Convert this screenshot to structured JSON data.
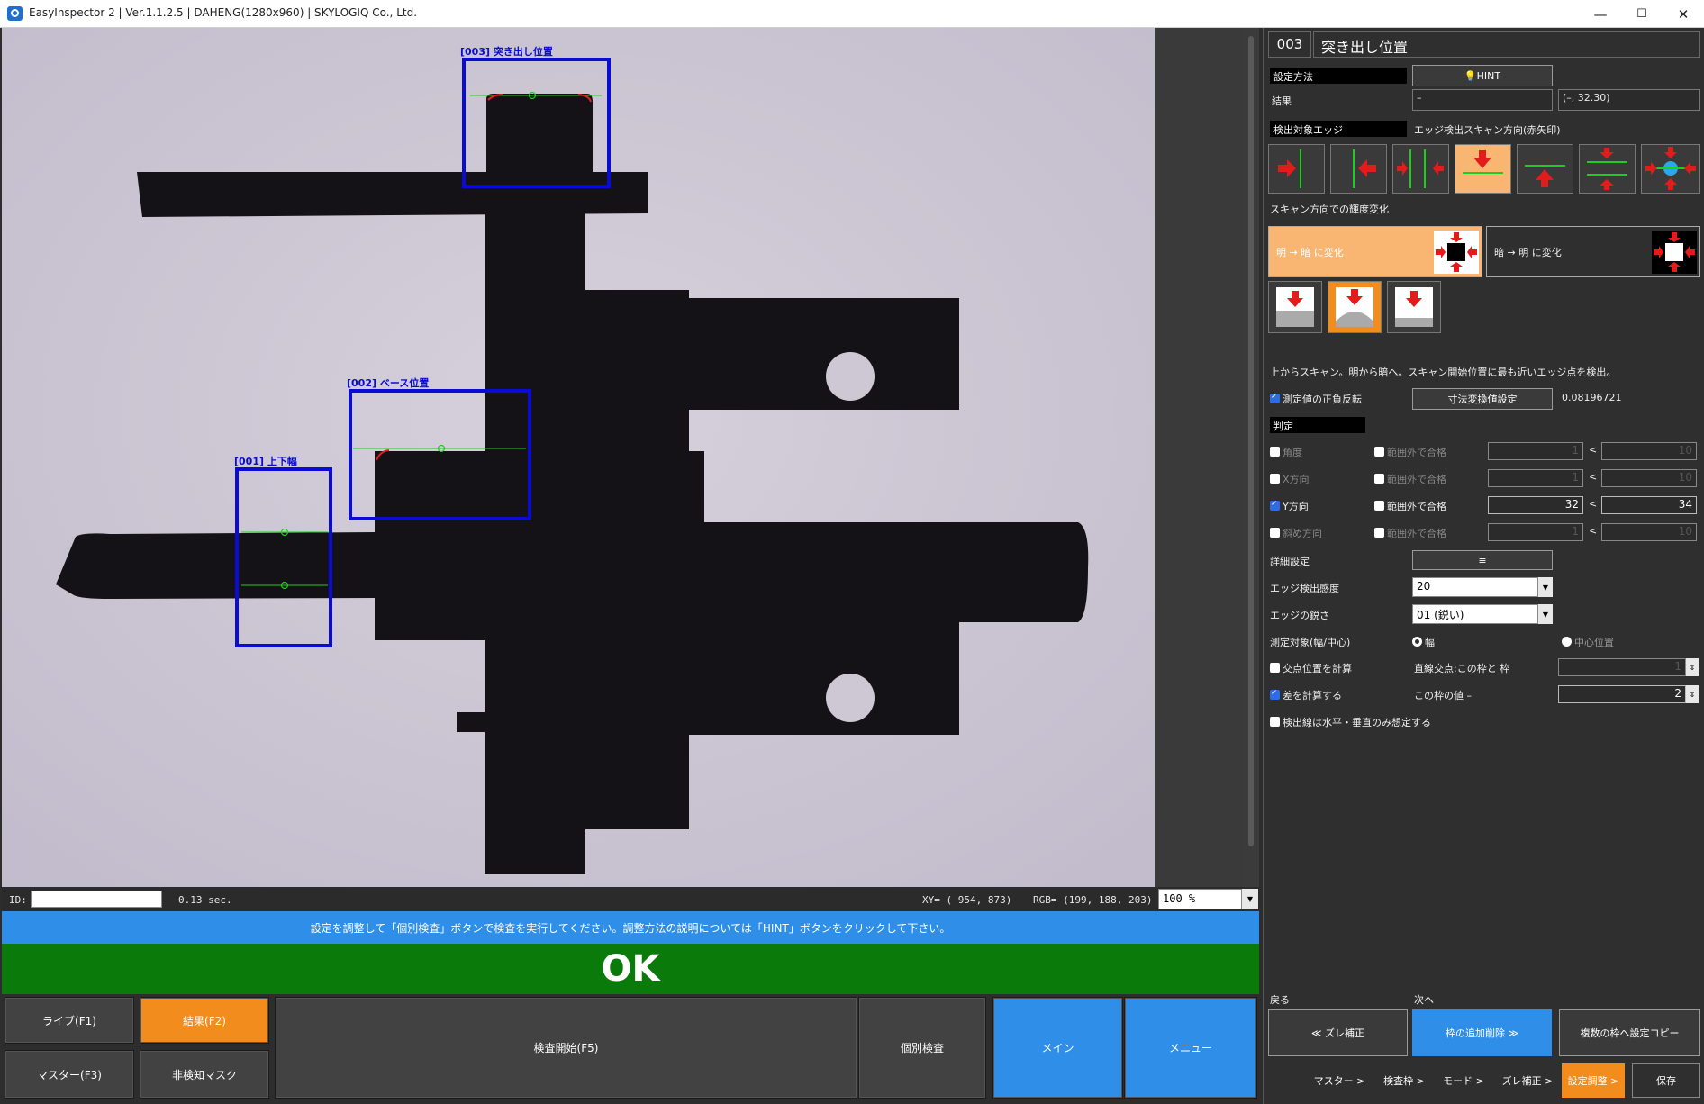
{
  "window": {
    "title": "EasyInspector 2 | Ver.1.1.2.5 | DAHENG(1280x960) | SKYLOGIQ Co., Ltd.",
    "minimize": "—",
    "maximize": "☐",
    "close": "✕"
  },
  "viewer": {
    "rois": [
      {
        "label": "[003] 突き出し位置"
      },
      {
        "label": "[002] ベース位置"
      },
      {
        "label": "[001] 上下幅"
      }
    ]
  },
  "status": {
    "id_label": "ID:",
    "id_value": "",
    "time": "0.13 sec.",
    "xy": "XY= ( 954,  873)",
    "rgb": "RGB= (199, 188, 203)",
    "zoom": "100 %"
  },
  "instruction": "設定を調整して「個別検査」ボタンで検査を実行してください。調整方法の説明については「HINT」ボタンをクリックして下さい。",
  "result": "OK",
  "bottom_buttons": {
    "live": "ライブ(F1)",
    "result": "結果(F2)",
    "master": "マスター(F3)",
    "nondetect_mask": "非検知マスク",
    "start": "検査開始(F5)",
    "individual": "個別検査",
    "main": "メイン",
    "menu": "メニュー"
  },
  "panel": {
    "roi_id": "003",
    "roi_name": "突き出し位置",
    "setting_method": "設定方法",
    "hint": "HINT",
    "result_label": "結果",
    "result_value": "–",
    "result_coords": "(–, 32.30)",
    "target_edge": "検出対象エッジ",
    "scan_direction": "エッジ検出スキャン方向(赤矢印)",
    "brightness_change": "スキャン方向での輝度変化",
    "light_to_dark": "明 → 暗 に変化",
    "dark_to_light": "暗 → 明 に変化",
    "description": "上からスキャン。明から暗へ。スキャン開始位置に最も近いエッジ点を検出。",
    "invert_sign": "測定値の正負反転",
    "dimension_convert": "寸法変換値設定",
    "scale_value": "0.08196721",
    "judgement": "判定",
    "criteria": [
      {
        "label": "角度",
        "pass_label": "範囲外で合格",
        "min": "1",
        "max": "10",
        "checked": false
      },
      {
        "label": "X方向",
        "pass_label": "範囲外で合格",
        "min": "1",
        "max": "10",
        "checked": false
      },
      {
        "label": "Y方向",
        "pass_label": "範囲外で合格",
        "min": "32",
        "max": "34",
        "checked": true
      },
      {
        "label": "斜め方向",
        "pass_label": "範囲外で合格",
        "min": "1",
        "max": "10",
        "checked": false
      }
    ],
    "lt": "<",
    "detail_settings": "詳細設定",
    "detail_icon": "≡",
    "edge_sensitivity_label": "エッジ検出感度",
    "edge_sensitivity_value": "20",
    "edge_sharpness_label": "エッジの鋭さ",
    "edge_sharpness_value": "01 (鋭い)",
    "measure_target_label": "測定対象(幅/中心)",
    "measure_width": "幅",
    "measure_center": "中心位置",
    "calc_intersection": "交点位置を計算",
    "line_intersection": "直線交点:この枠と 枠",
    "intersection_value": "1",
    "calc_difference": "差を計算する",
    "frame_value_minus": "この枠の値 –",
    "difference_value": "2",
    "hv_only": "検出線は水平・垂直のみ想定する",
    "back": "戻る",
    "next": "次へ",
    "back_button": "≪ ズレ補正",
    "add_remove": "枠の追加削除 ≫",
    "copy_settings": "複数の枠へ設定コピー",
    "nav": [
      "マスター >",
      "検査枠 >",
      "モード >",
      "ズレ補正 >",
      "設定調整 >",
      "保存"
    ]
  }
}
